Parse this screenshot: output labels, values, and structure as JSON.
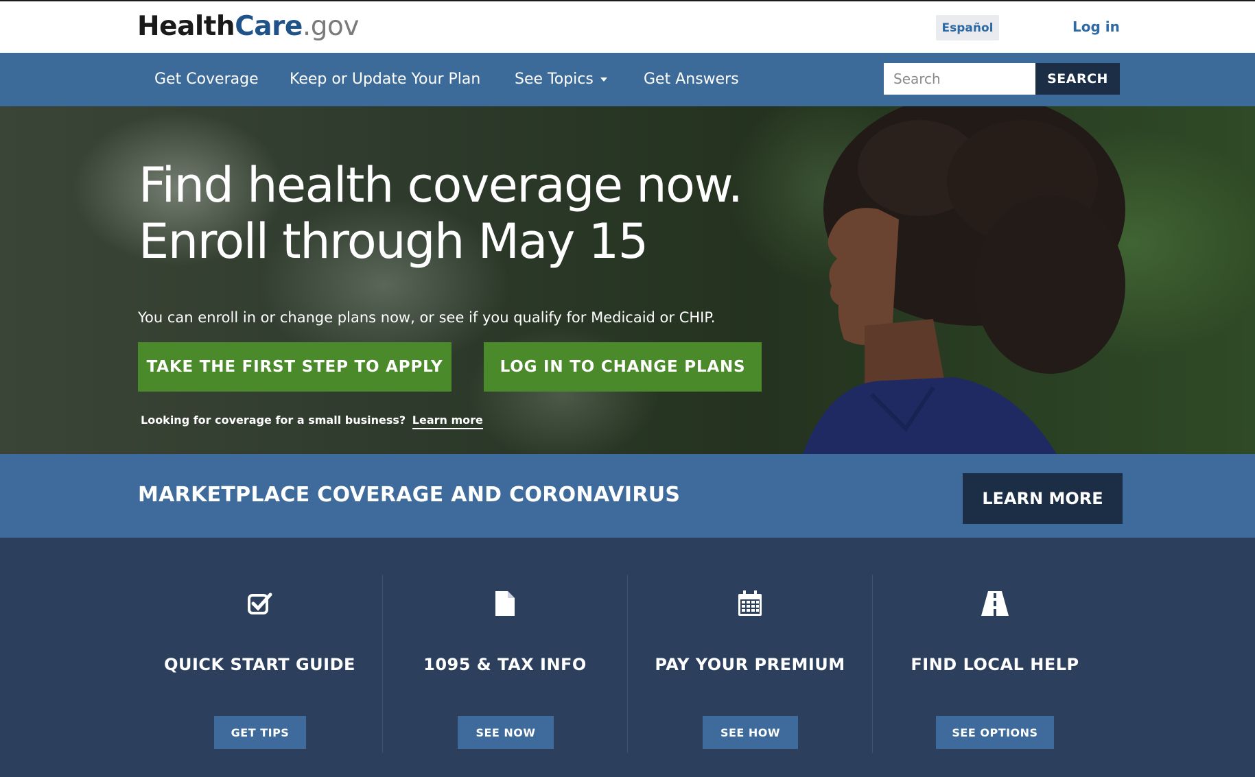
{
  "header": {
    "logo": {
      "health": "Health",
      "care": "Care",
      "gov": ".gov"
    },
    "espanol_label": "Español",
    "login_label": "Log in"
  },
  "nav": {
    "items": [
      {
        "label": "Get Coverage"
      },
      {
        "label": "Keep or Update Your Plan"
      },
      {
        "label": "See Topics"
      },
      {
        "label": "Get Answers"
      }
    ],
    "search": {
      "placeholder": "Search",
      "button_label": "SEARCH"
    }
  },
  "hero": {
    "title_line1": "Find health coverage now.",
    "title_line2": "Enroll through May 15",
    "subtitle": "You can enroll in or change plans now, or see if you qualify for Medicaid or CHIP.",
    "apply_button": "TAKE THE FIRST STEP TO APPLY",
    "change_button": "LOG IN TO CHANGE PLANS",
    "small_business_text": "Looking for coverage for a small business?",
    "small_business_link": "Learn more"
  },
  "banner": {
    "title": "MARKETPLACE COVERAGE AND CORONAVIRUS",
    "button_label": "LEARN MORE"
  },
  "cards": [
    {
      "icon": "checkbox-icon",
      "title": "QUICK START GUIDE",
      "button": "GET TIPS"
    },
    {
      "icon": "document-icon",
      "title": "1095 & TAX INFO",
      "button": "SEE NOW"
    },
    {
      "icon": "calendar-icon",
      "title": "PAY YOUR PREMIUM",
      "button": "SEE HOW"
    },
    {
      "icon": "road-icon",
      "title": "FIND LOCAL HELP",
      "button": "SEE OPTIONS"
    }
  ],
  "colors": {
    "nav_blue": "#3d6b99",
    "dark_navy": "#1c2e45",
    "cta_green": "#4b8a2a",
    "card_bg": "#2c3f5c"
  }
}
